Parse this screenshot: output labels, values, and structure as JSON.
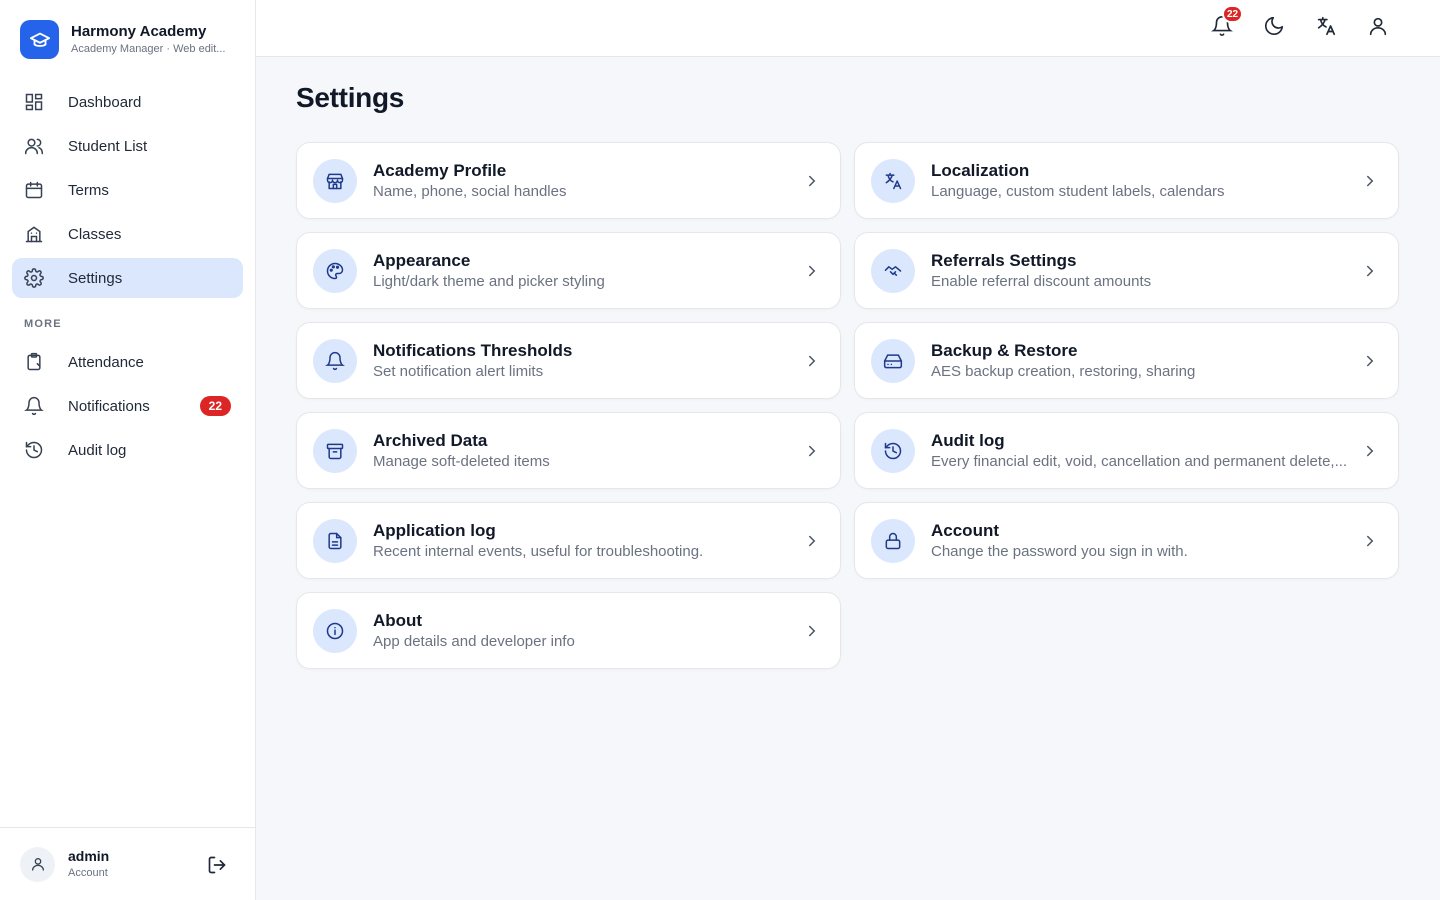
{
  "brand": {
    "title": "Harmony Academy",
    "subtitle": "Academy Manager · Web edit..."
  },
  "sidebar": {
    "items": [
      {
        "label": "Dashboard",
        "icon": "dashboard-icon"
      },
      {
        "label": "Student List",
        "icon": "users-icon"
      },
      {
        "label": "Terms",
        "icon": "calendar-icon"
      },
      {
        "label": "Classes",
        "icon": "building-icon"
      },
      {
        "label": "Settings",
        "icon": "gear-icon",
        "active": true
      }
    ],
    "section_label": "MORE",
    "more_items": [
      {
        "label": "Attendance",
        "icon": "clipboard-icon"
      },
      {
        "label": "Notifications",
        "icon": "bell-icon",
        "badge": "22"
      },
      {
        "label": "Audit log",
        "icon": "history-icon"
      }
    ]
  },
  "user": {
    "name": "admin",
    "role": "Account"
  },
  "topbar": {
    "notification_count": "22"
  },
  "main": {
    "title": "Settings",
    "cards": [
      {
        "title": "Academy Profile",
        "subtitle": "Name, phone, social handles",
        "icon": "store-icon"
      },
      {
        "title": "Localization",
        "subtitle": "Language, custom student labels, calendars",
        "icon": "translate-icon"
      },
      {
        "title": "Appearance",
        "subtitle": "Light/dark theme and picker styling",
        "icon": "palette-icon"
      },
      {
        "title": "Referrals Settings",
        "subtitle": "Enable referral discount amounts",
        "icon": "handshake-icon"
      },
      {
        "title": "Notifications Thresholds",
        "subtitle": "Set notification alert limits",
        "icon": "bell-icon"
      },
      {
        "title": "Backup & Restore",
        "subtitle": "AES backup creation, restoring, sharing",
        "icon": "hard-drive-icon"
      },
      {
        "title": "Archived Data",
        "subtitle": "Manage soft-deleted items",
        "icon": "archive-icon"
      },
      {
        "title": "Audit log",
        "subtitle": "Every financial edit, void, cancellation and permanent delete,...",
        "icon": "history-icon"
      },
      {
        "title": "Application log",
        "subtitle": "Recent internal events, useful for troubleshooting.",
        "icon": "file-text-icon"
      },
      {
        "title": "Account",
        "subtitle": "Change the password you sign in with.",
        "icon": "lock-icon"
      },
      {
        "title": "About",
        "subtitle": "App details and developer info",
        "icon": "info-icon"
      }
    ]
  },
  "colors": {
    "accent": "#2563eb",
    "active_bg": "#dbe7fd",
    "badge": "#dc2626"
  }
}
